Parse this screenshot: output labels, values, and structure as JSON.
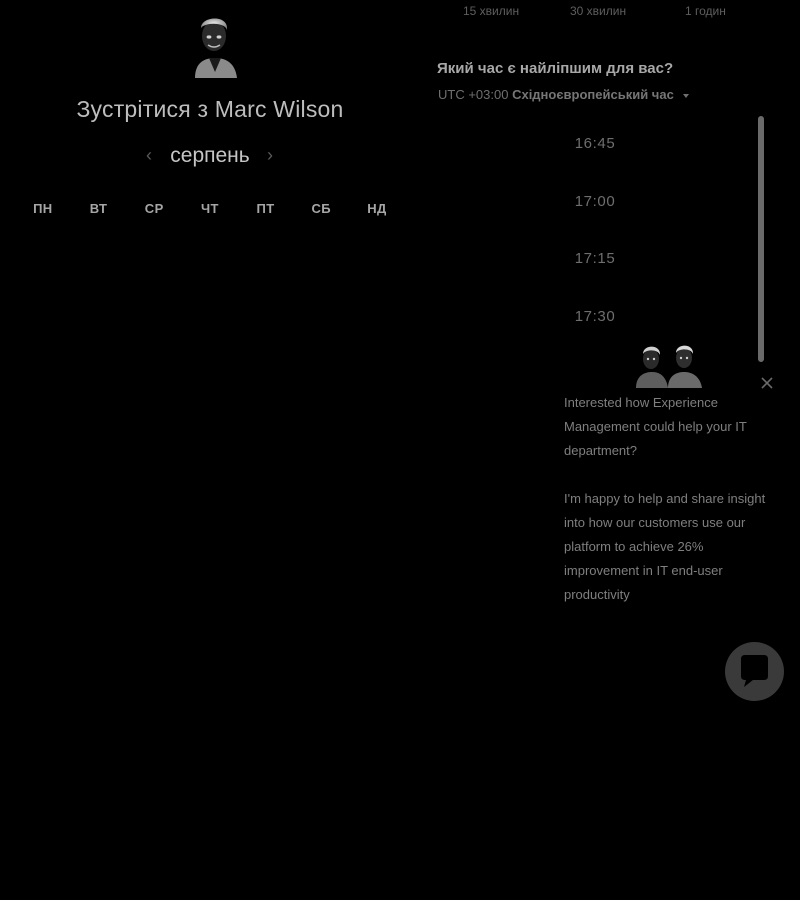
{
  "header": {
    "title": "Зустрітися з Marc Wilson"
  },
  "calendar": {
    "month": "серпень",
    "prev_icon": "chevron-left-icon",
    "next_icon": "chevron-right-icon",
    "weekdays": [
      "ПН",
      "ВТ",
      "СР",
      "ЧТ",
      "ПТ",
      "СБ",
      "НД"
    ]
  },
  "durations": [
    "15 хвилин",
    "30 хвилин",
    "1 годин"
  ],
  "booking": {
    "question": "Який час є найліпшим для вас?",
    "timezone_offset": "UTC +03:00",
    "timezone_name": "Східноєвропейський час",
    "slots": [
      "16:45",
      "17:00",
      "17:15",
      "17:30"
    ]
  },
  "chat": {
    "message_1": "Interested how Experience Management could help your IT department?",
    "message_2": "I'm happy to help and share insight into how our customers use our platform to achieve 26% improvement in IT end-user productivity",
    "close_icon": "close-icon",
    "launcher_icon": "chat-bubble-icon"
  },
  "colors": {
    "background": "#000000",
    "text_primary": "#bdbdbd",
    "text_muted": "#6e6e6e"
  }
}
